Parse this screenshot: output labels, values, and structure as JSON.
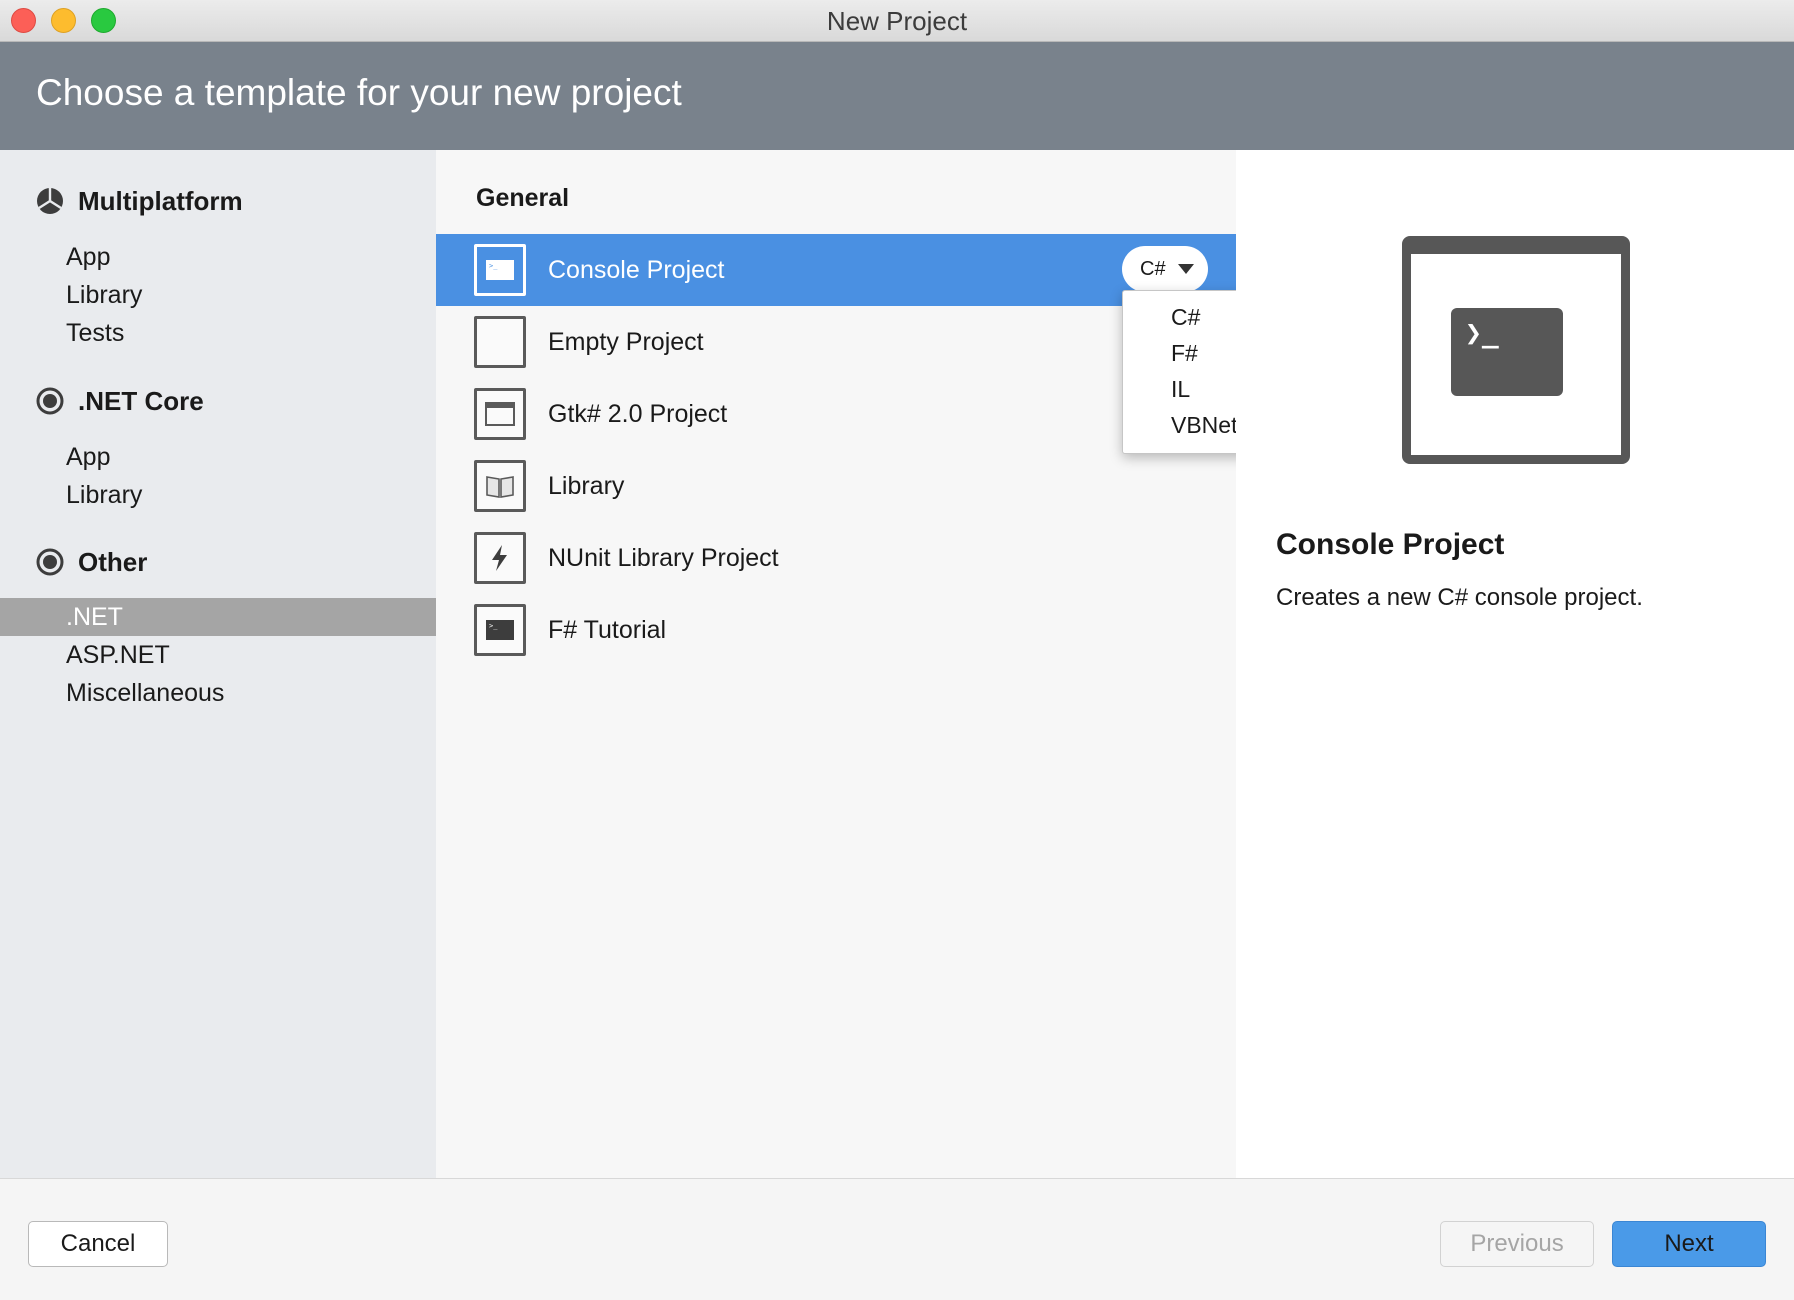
{
  "window": {
    "title": "New Project"
  },
  "banner": {
    "title": "Choose a template for your new project"
  },
  "sidebar": {
    "categories": [
      {
        "label": "Multiplatform",
        "icon": "multiplatform-icon",
        "items": [
          "App",
          "Library",
          "Tests"
        ]
      },
      {
        "label": ".NET Core",
        "icon": "radio-circle-icon",
        "items": [
          "App",
          "Library"
        ]
      },
      {
        "label": "Other",
        "icon": "radio-circle-icon",
        "items": [
          ".NET",
          "ASP.NET",
          "Miscellaneous"
        ]
      }
    ],
    "selected_item": ".NET"
  },
  "templates": {
    "section_title": "General",
    "items": [
      {
        "label": "Console Project",
        "icon": "console-icon",
        "selected": true
      },
      {
        "label": "Empty Project",
        "icon": "empty-project-icon",
        "selected": false
      },
      {
        "label": "Gtk# 2.0 Project",
        "icon": "window-icon",
        "selected": false
      },
      {
        "label": "Library",
        "icon": "book-icon",
        "selected": false
      },
      {
        "label": "NUnit Library Project",
        "icon": "lightning-icon",
        "selected": false
      },
      {
        "label": "F# Tutorial",
        "icon": "console-icon",
        "selected": false
      }
    ],
    "language": {
      "selected": "C#",
      "options": [
        "C#",
        "F#",
        "IL",
        "VBNet"
      ]
    }
  },
  "preview": {
    "prompt_glyph": "❯_",
    "title": "Console Project",
    "description": "Creates a new C# console project."
  },
  "footer": {
    "cancel_label": "Cancel",
    "previous_label": "Previous",
    "next_label": "Next"
  },
  "colors": {
    "accent": "#4a90e2",
    "banner": "#79828c",
    "sidebar_selected": "#a5a5a5"
  }
}
